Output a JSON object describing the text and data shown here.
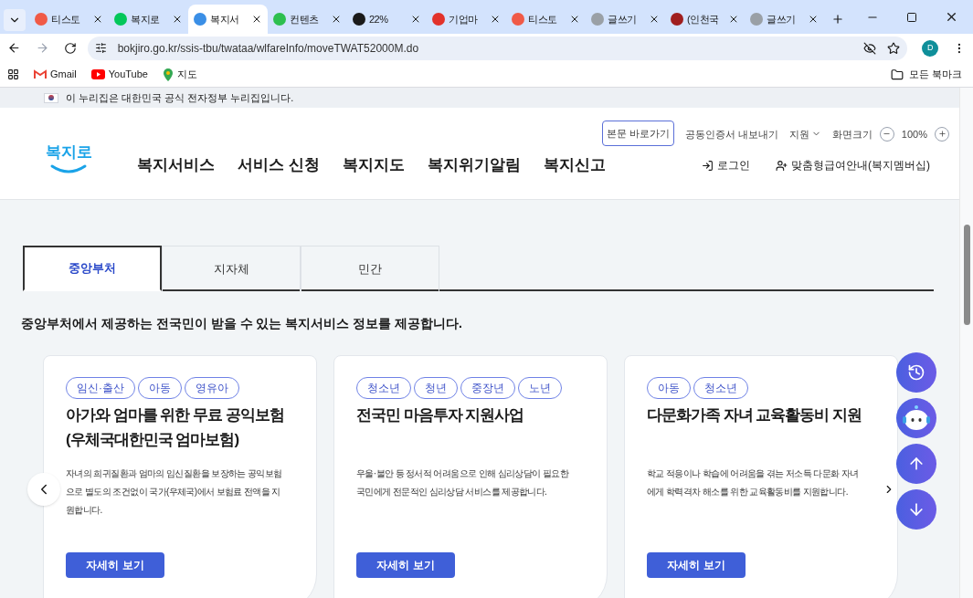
{
  "browser": {
    "tabs": [
      {
        "title": "티스토",
        "selected": false,
        "color": "#f05a47"
      },
      {
        "title": "복지로",
        "selected": false,
        "color": "#03c75a"
      },
      {
        "title": "복지서",
        "selected": true,
        "color": "#3b8fe6"
      },
      {
        "title": "컨텐츠",
        "selected": false,
        "color": "#2dbf4f"
      },
      {
        "title": "22%",
        "selected": false,
        "color": "#1a1a1a"
      },
      {
        "title": "기업마",
        "selected": false,
        "color": "#e2322b"
      },
      {
        "title": "티스토",
        "selected": false,
        "color": "#f05a47"
      },
      {
        "title": "글쓰기",
        "selected": false,
        "color": "#9aa0a6"
      },
      {
        "title": "(인천국",
        "selected": false,
        "color": "#a01e1e"
      },
      {
        "title": "글쓰기",
        "selected": false,
        "color": "#9aa0a6"
      }
    ],
    "address": "bokjiro.go.kr/ssis-tbu/twataa/wlfareInfo/moveTWAT52000M.do",
    "profile": "D",
    "bookmarks": [
      {
        "label": "Gmail",
        "kind": "gmail"
      },
      {
        "label": "YouTube",
        "kind": "youtube"
      },
      {
        "label": "지도",
        "kind": "maps"
      }
    ],
    "all_bookmarks": "모든 북마크"
  },
  "gov_banner": "이 누리집은 대한민국 공식 전자정부 누리집입니다.",
  "header": {
    "logo": "복지로",
    "skip_link": "본문 바로가기",
    "utility": [
      "공동인증서 내보내기",
      "지원"
    ],
    "zoom_label": "화면크기",
    "zoom_value": "100%",
    "nav": [
      "복지서비스",
      "서비스 신청",
      "복지지도",
      "복지위기알림",
      "복지신고"
    ],
    "login": "로그인",
    "membership": "맞춤형급여안내(복지멤버십)"
  },
  "section_tabs": [
    {
      "label": "중앙부처",
      "selected": true
    },
    {
      "label": "지자체",
      "selected": false
    },
    {
      "label": "민간",
      "selected": false
    }
  ],
  "intro": "중앙부처에서 제공하는 전국민이 받을 수 있는 복지서비스 정보를 제공합니다.",
  "cards": [
    {
      "tags": [
        "임신·출산",
        "아동",
        "영유아"
      ],
      "title": "아가와 엄마를 위한 무료 공익보험(우체국대한민국 엄마보험)",
      "description": "자녀의 희귀질환과 엄마의 임신질환을 보장하는 공익보험으로 별도의 조건없이 국가(우체국)에서 보험료 전액을 지원합니다.",
      "button": "자세히 보기"
    },
    {
      "tags": [
        "청소년",
        "청년",
        "중장년",
        "노년"
      ],
      "title": "전국민 마음투자 지원사업",
      "description": "우울·불안 등 정서적 어려움으로 인해 심리상담이 필요한 국민에게 전문적인 심리상담 서비스를 제공합니다.",
      "button": "자세히 보기"
    },
    {
      "tags": [
        "아동",
        "청소년"
      ],
      "title": "다문화가족 자녀 교육활동비 지원",
      "description": "학교 적응이나 학습에 어려움을 겪는 저소득 다문화 자녀에게 학력격차 해소를 위한 교육활동비를 지원합니다.",
      "button": "자세히 보기"
    }
  ]
}
